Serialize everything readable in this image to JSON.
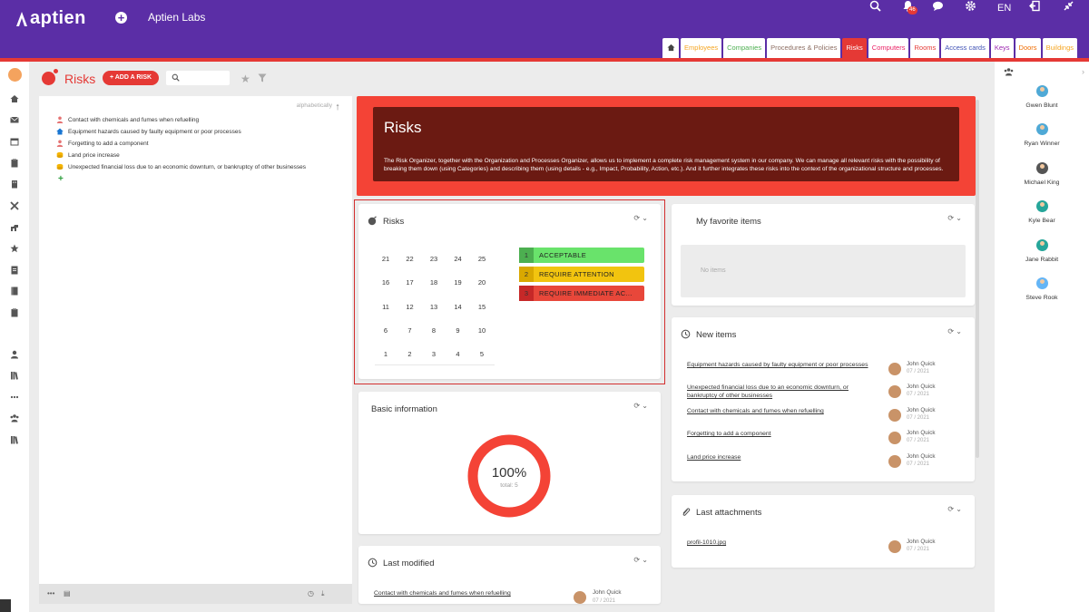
{
  "header": {
    "logo": "aptien",
    "company": "Aptien Labs",
    "language": "EN",
    "notifications_count": "46"
  },
  "tabs": [
    "Employees",
    "Companies",
    "Procedures & Policies",
    "Risks",
    "Computers",
    "Rooms",
    "Access cards",
    "Keys",
    "Doors",
    "Buildings"
  ],
  "tab_colors": [
    "#f5a623",
    "#4caf50",
    "#8d6e63",
    "#ffffff",
    "#e91e63",
    "#e53935",
    "#3f51b5",
    "#9c27b0",
    "#ef6c00",
    "#f5a623"
  ],
  "page": {
    "title": "Risks",
    "add_button": "+ ADD A RISK",
    "search_placeholder": ""
  },
  "list": {
    "sort_label": "alphabetically",
    "items": [
      {
        "label": "Contact with chemicals and fumes when refuelling",
        "icon": "person-icon",
        "color": "#e57373"
      },
      {
        "label": "Equipment hazards caused by faulty equipment or poor processes",
        "icon": "home-icon",
        "color": "#1976d2"
      },
      {
        "label": "Forgetting to add a component",
        "icon": "person-icon",
        "color": "#e57373"
      },
      {
        "label": "Land price increase",
        "icon": "coins-icon",
        "color": "#f5b400"
      },
      {
        "label": "Unexpected financial loss due to an economic downturn, or bankruptcy of other businesses",
        "icon": "coins-icon",
        "color": "#f5b400"
      }
    ]
  },
  "banner": {
    "title": "Risks",
    "text": "The Risk Organizer, together with the Organization and Processes Organizer, allows us to implement a complete risk management system in our company. We can manage all relevant risks with the possibility of breaking them down (using Categories) and describing them (using details - e.g., Impact, Probability, Action, etc.). And it further integrates these risks into the context of the organizational structure and processes."
  },
  "risks_card": {
    "title": "Risks",
    "grid": [
      [
        "21",
        "22",
        "23",
        "24",
        "25"
      ],
      [
        "16",
        "17",
        "18",
        "19",
        "20"
      ],
      [
        "11",
        "12",
        "13",
        "14",
        "15"
      ],
      [
        "6",
        "7",
        "8",
        "9",
        "10"
      ],
      [
        "1",
        "2",
        "3",
        "4",
        "5"
      ]
    ],
    "legend": [
      {
        "num": "1",
        "label": "ACCEPTABLE",
        "color": "#69e36b",
        "num_color": "#4caf50"
      },
      {
        "num": "2",
        "label": "REQUIRE ATTENTION",
        "color": "#f2c40f",
        "num_color": "#d9a800"
      },
      {
        "num": "3",
        "label": "REQUIRE IMMEDIATE AC...",
        "color": "#e8473a",
        "num_color": "#c62828"
      }
    ]
  },
  "favorites_card": {
    "title": "My favorite items",
    "empty_text": "No items"
  },
  "basic_info_card": {
    "title": "Basic information",
    "percent": "100%",
    "total": "total: 5",
    "donut_fraction": 1.0,
    "donut_color": "#f44336"
  },
  "new_items_card": {
    "title": "New items",
    "items": [
      {
        "label": "Equipment hazards caused by faulty equipment or poor processes",
        "user": "John Quick",
        "date": "07 / 2021"
      },
      {
        "label": "Unexpected financial loss due to an economic downturn, or bankruptcy of other businesses",
        "user": "John Quick",
        "date": "07 / 2021"
      },
      {
        "label": "Contact with chemicals and fumes when refuelling",
        "user": "John Quick",
        "date": "07 / 2021"
      },
      {
        "label": "Forgetting to add a component",
        "user": "John Quick",
        "date": "07 / 2021"
      },
      {
        "label": "Land price increase",
        "user": "John Quick",
        "date": "07 / 2021"
      }
    ]
  },
  "attachments_card": {
    "title": "Last attachments",
    "items": [
      {
        "label": "profil-1010.jpg",
        "user": "John Quick",
        "date": "07 / 2021"
      }
    ]
  },
  "last_modified_card": {
    "title": "Last modified",
    "items": [
      {
        "label": "Contact with chemicals and fumes when refuelling",
        "user": "John Quick",
        "date": "07 / 2021"
      }
    ]
  },
  "users": [
    "Gwen Blunt",
    "Ryan Winner",
    "Michael King",
    "Kyle Bear",
    "Jane Rabbit",
    "Steve Rook"
  ]
}
